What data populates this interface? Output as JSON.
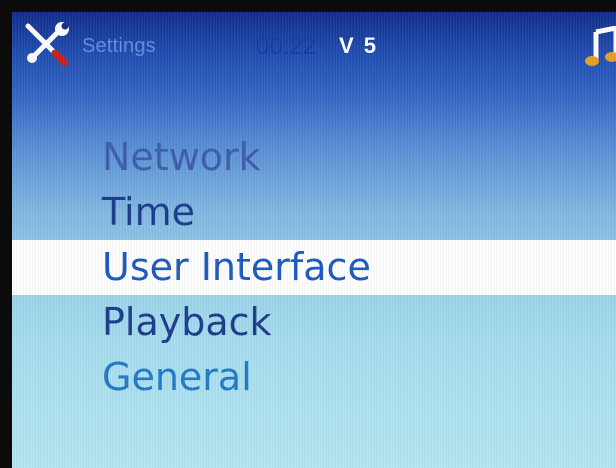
{
  "status_bar": {
    "icon": "wrench-screwdriver-icon",
    "title": "Settings",
    "clock": "00:22",
    "volume": "V 5",
    "right_icon": "music-note-icon"
  },
  "menu": {
    "items": [
      {
        "label": "Network"
      },
      {
        "label": "Time"
      },
      {
        "label": "User Interface"
      },
      {
        "label": "Playback"
      },
      {
        "label": "General"
      }
    ],
    "selected": "User Interface"
  },
  "colors": {
    "header": "#0f2c8a",
    "background_bottom": "#b6e6f2",
    "highlight": "#ffffff",
    "menu_text": "#1a3a8a",
    "selected_text": "#1a57c0"
  }
}
